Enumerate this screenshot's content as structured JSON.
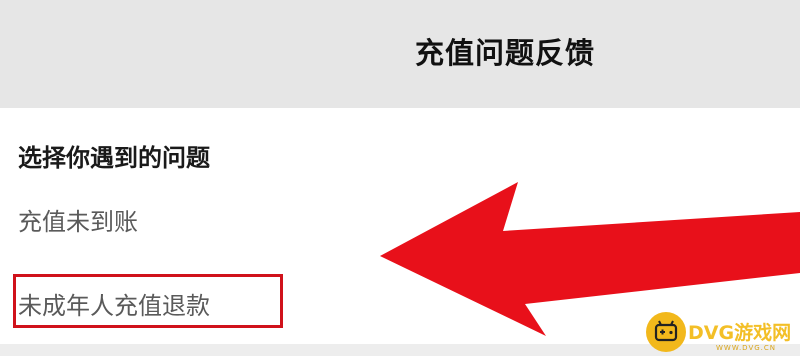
{
  "header": {
    "title": "充值问题反馈"
  },
  "section": {
    "heading": "选择你遇到的问题"
  },
  "options": [
    {
      "label": "充值未到账",
      "highlighted": false
    },
    {
      "label": "未成年人充值退款",
      "highlighted": true
    }
  ],
  "annotation": {
    "arrow_color": "#e8101a",
    "highlight_color": "#d0121b"
  },
  "watermark": {
    "title": "DVG游戏网",
    "subtitle": "WWW.DVG.CN",
    "icon": "gamepad-icon"
  },
  "colors": {
    "header_bg": "#e6e6e6",
    "watermark": "#f2b81b"
  }
}
